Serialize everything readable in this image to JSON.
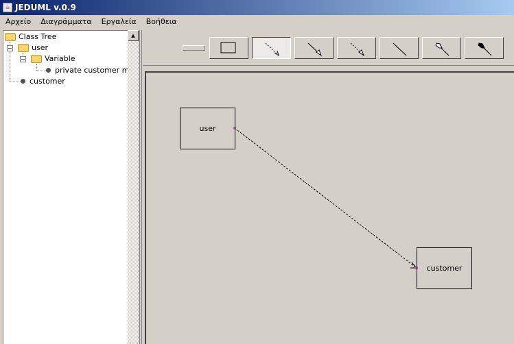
{
  "window": {
    "title": "JEDUML v.0.9"
  },
  "menu": [
    "Αρχείο",
    "Διαγράμματα",
    "Εργαλεία",
    "Βοήθεια"
  ],
  "tree": {
    "root": "Class Tree",
    "user": "user",
    "variable": "Variable",
    "field": "private customer m_c",
    "customer": "customer"
  },
  "toolbar": {
    "tools": [
      "class",
      "dashed-arrow",
      "arrow",
      "dashed-open-arrow",
      "line",
      "aggregation",
      "composition"
    ],
    "selected": "dashed-arrow"
  },
  "diagram": {
    "classes": [
      {
        "name": "user"
      },
      {
        "name": "customer"
      }
    ],
    "connection": {
      "from": "user",
      "to": "customer",
      "style": "dashed-arrow"
    },
    "handle_color": "#b070c0"
  }
}
